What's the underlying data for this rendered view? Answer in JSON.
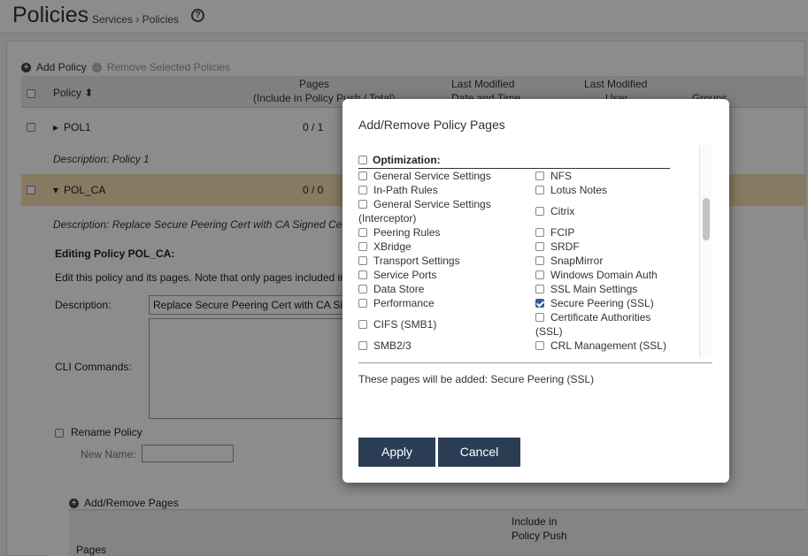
{
  "header": {
    "title": "Policies",
    "breadcrumb": "Services › Policies",
    "help_glyph": "?"
  },
  "toolbar": {
    "add_policy": "Add Policy",
    "remove_selected": "Remove Selected Policies"
  },
  "table": {
    "columns": {
      "policy": "Policy ⬍",
      "pages_top": "Pages",
      "pages_bottom": "(Include in Policy Push / Total)",
      "modified_dt_top": "Last Modified",
      "modified_dt_bottom": "Date and Time",
      "modified_user_top": "Last Modified",
      "modified_user_bottom": "User",
      "groups": "Groups"
    },
    "rows": [
      {
        "name": "POL1",
        "pages": "0 / 1",
        "description": "Description: Policy 1"
      },
      {
        "name": "POL_CA",
        "pages": "0 / 0",
        "description": "Description: Replace Secure Peering Cert with CA Signed Cert"
      }
    ]
  },
  "editor": {
    "heading": "Editing Policy POL_CA:",
    "intro": "Edit this policy and its pages. Note that only pages included in",
    "description_label": "Description:",
    "description_value": "Replace Secure Peering Cert with CA Signed Cert",
    "cli_label": "CLI Commands:",
    "rename_label": "Rename Policy",
    "new_name_label": "New Name:",
    "add_remove_pages": "Add/Remove Pages",
    "include_top": "Include in",
    "include_bottom": "Policy Push",
    "pages_col_label": "Pages"
  },
  "modal": {
    "title": "Add/Remove Policy Pages",
    "section": "Optimization:",
    "left_items": [
      "General Service Settings",
      "In-Path Rules",
      "General Service Settings",
      "(Interceptor)",
      "Peering Rules",
      "XBridge",
      "Transport Settings",
      "Service Ports",
      "Data Store",
      "Performance",
      "CIFS (SMB1)",
      "SMB2/3"
    ],
    "right_items": [
      {
        "label": "NFS",
        "checked": false
      },
      {
        "label": "Lotus Notes",
        "checked": false
      },
      {
        "label": "Citrix",
        "checked": false
      },
      {
        "label": "FCIP",
        "checked": false
      },
      {
        "label": "SRDF",
        "checked": false
      },
      {
        "label": "SnapMirror",
        "checked": false
      },
      {
        "label": "Windows Domain Auth",
        "checked": false
      },
      {
        "label": "SSL Main Settings",
        "checked": false
      },
      {
        "label": "Secure Peering (SSL)",
        "checked": true
      },
      {
        "label": "Certificate Authorities",
        "checked": false
      },
      {
        "label": "(SSL)",
        "checked": false
      },
      {
        "label": "CRL Management (SSL)",
        "checked": false
      }
    ],
    "summary": "These pages will be added: Secure Peering (SSL)",
    "apply": "Apply",
    "cancel": "Cancel"
  }
}
